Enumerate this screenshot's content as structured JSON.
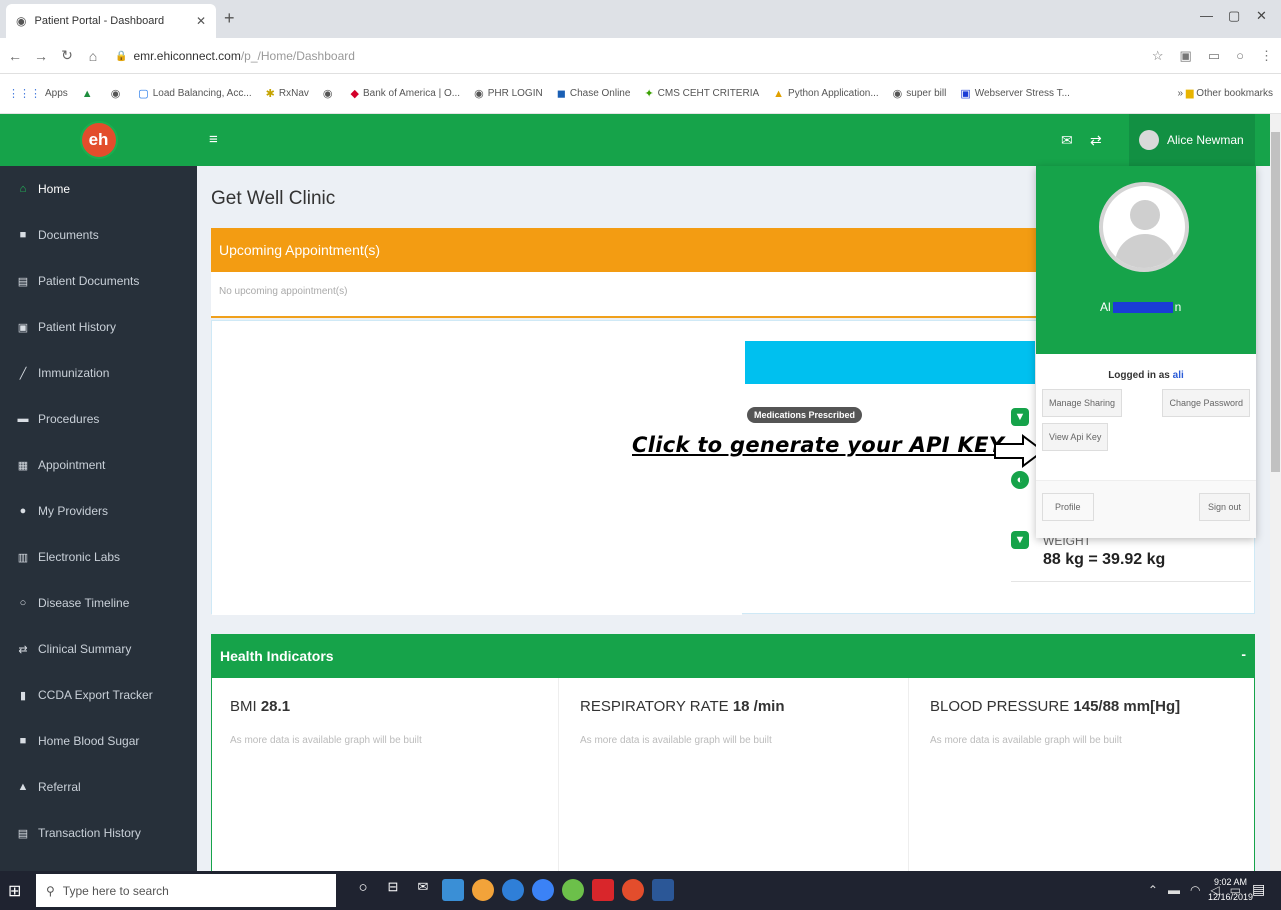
{
  "browser": {
    "tab_title": "Patient Portal - Dashboard",
    "url_host": "emr.ehiconnect.com",
    "url_path": "/p_/Home/Dashboard",
    "bookmarks": [
      "Apps",
      "",
      "",
      "Load Balancing, Acc...",
      "RxNav",
      "",
      "Bank of America | O...",
      "PHR LOGIN",
      "Chase Online",
      "CMS CEHT CRITERIA",
      "Python Application...",
      "super bill",
      "Webserver Stress T..."
    ],
    "other_bookmarks": "Other bookmarks"
  },
  "app": {
    "logo_text": "eh",
    "user_name": "Alice Newman",
    "clinic_name": "Get Well Clinic",
    "colors": {
      "primary": "#16a34a",
      "sidebar": "#27303a",
      "warning": "#f39c12",
      "info": "#00c0ef"
    }
  },
  "sidebar": {
    "items": [
      {
        "label": "Home",
        "icon": "home-icon"
      },
      {
        "label": "Documents",
        "icon": "folder-icon"
      },
      {
        "label": "Patient Documents",
        "icon": "document-icon"
      },
      {
        "label": "Patient History",
        "icon": "history-icon"
      },
      {
        "label": "Immunization",
        "icon": "syringe-icon"
      },
      {
        "label": "Procedures",
        "icon": "bed-icon"
      },
      {
        "label": "Appointment",
        "icon": "calendar-icon"
      },
      {
        "label": "My Providers",
        "icon": "users-icon"
      },
      {
        "label": "Electronic Labs",
        "icon": "chart-icon"
      },
      {
        "label": "Disease Timeline",
        "icon": "circle-icon"
      },
      {
        "label": "Clinical Summary",
        "icon": "exchange-icon"
      },
      {
        "label": "CCDA Export Tracker",
        "icon": "file-icon"
      },
      {
        "label": "Home Blood Sugar",
        "icon": "book-icon"
      },
      {
        "label": "Referral",
        "icon": "warning-icon"
      },
      {
        "label": "Transaction History",
        "icon": "table-icon"
      }
    ]
  },
  "appointments": {
    "title": "Upcoming Appointment(s)",
    "empty_text": "No upcoming appointment(s)"
  },
  "medications": {
    "badge": "Medications Prescribed"
  },
  "annotation": {
    "text": "Click to generate your API KEY"
  },
  "vitals": {
    "weight_label": "WEIGHT",
    "weight_value": "88 kg = 39.92 kg"
  },
  "health": {
    "title": "Health Indicators",
    "collapse": "-",
    "indicators": [
      {
        "label": "BMI",
        "value": "28.1",
        "note": "As more data is available graph will be built"
      },
      {
        "label": "RESPIRATORY RATE",
        "value": "18 /min",
        "note": "As more data is available graph will be built"
      },
      {
        "label": "BLOOD PRESSURE",
        "value": "145/88 mm[Hg]",
        "note": "As more data is available graph will be built"
      }
    ]
  },
  "dropdown": {
    "name_start": "Al",
    "name_end": "n",
    "logged_in_prefix": "Logged in as",
    "logged_in_user": "ali",
    "manage_sharing": "Manage Sharing",
    "change_password": "Change Password",
    "view_api_key": "View Api Key",
    "profile": "Profile",
    "sign_out": "Sign out"
  },
  "taskbar": {
    "search_placeholder": "Type here to search",
    "time": "9:02 AM",
    "date": "12/16/2019"
  }
}
